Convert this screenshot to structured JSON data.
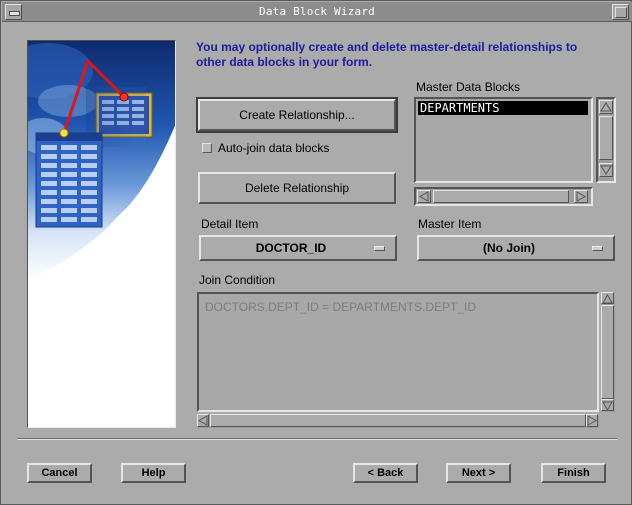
{
  "window": {
    "title": "Data Block Wizard"
  },
  "instruction": "You may optionally create and delete master-detail relationships to other data blocks in your form.",
  "buttons": {
    "create_relationship": "Create Relationship...",
    "delete_relationship": "Delete Relationship"
  },
  "autojoin": {
    "label": "Auto-join data blocks",
    "checked": false
  },
  "master_blocks": {
    "label": "Master Data Blocks",
    "items": [
      "DEPARTMENTS"
    ],
    "selected": "DEPARTMENTS"
  },
  "detail_item": {
    "label": "Detail Item",
    "value": "DOCTOR_ID"
  },
  "master_item": {
    "label": "Master Item",
    "value": "(No Join)"
  },
  "join_condition": {
    "label": "Join Condition",
    "value": "DOCTORS.DEPT_ID = DEPARTMENTS.DEPT_ID"
  },
  "footer": {
    "cancel": "Cancel",
    "help": "Help",
    "back": "< Back",
    "next": "Next >",
    "finish": "Finish"
  },
  "colors": {
    "instruction_text": "#1c1c9a",
    "dialog_background": "#ababab",
    "list_selection": "#000000"
  },
  "icons": {
    "title_menu": "window-menu-icon",
    "title_maximize": "maximize-icon",
    "illustration": "data-blocks-relationship-illustration",
    "option_menu_indicator": "option-menu-indicator-icon"
  }
}
